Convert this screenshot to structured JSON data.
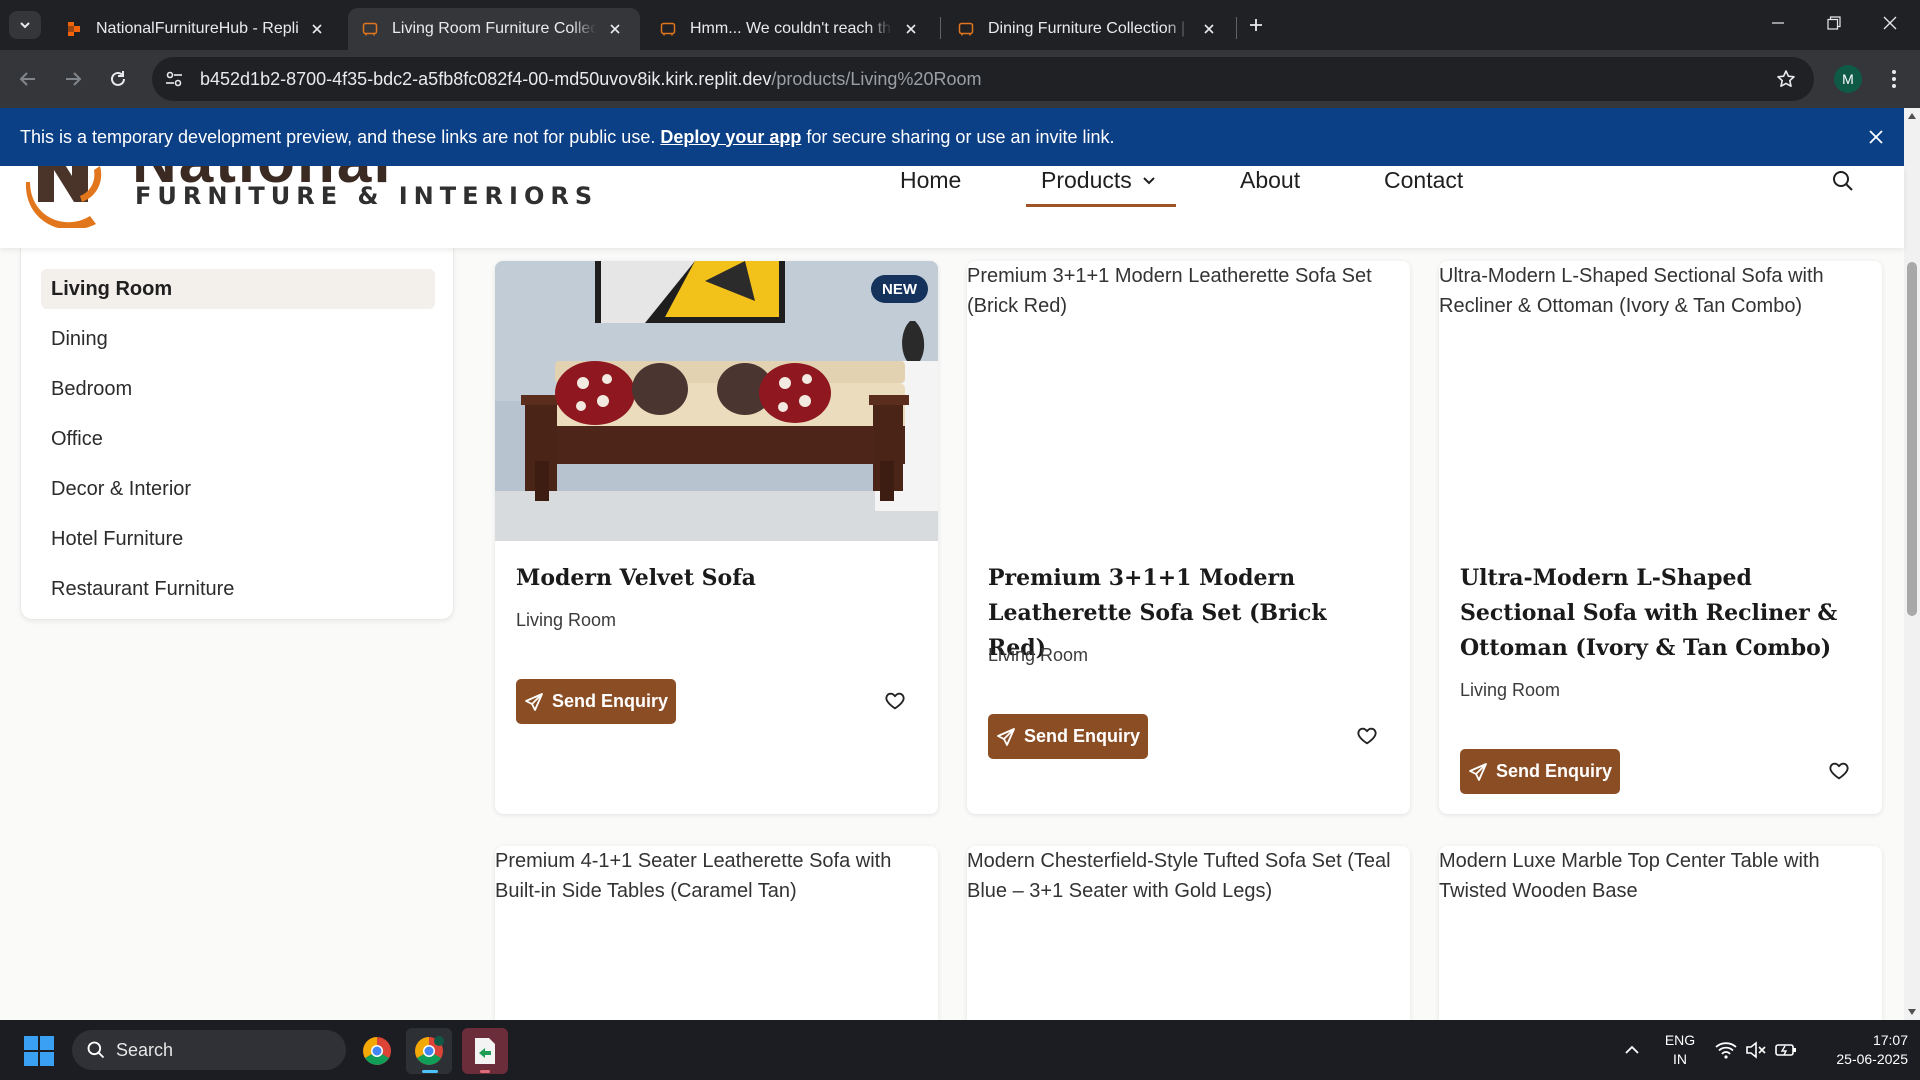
{
  "browser": {
    "tabs": [
      {
        "title": "NationalFurnitureHub - Replit",
        "active": false
      },
      {
        "title": "Living Room Furniture Collectio",
        "active": true
      },
      {
        "title": "Hmm... We couldn't reach this a",
        "active": false
      },
      {
        "title": "Dining Furniture Collection | Na",
        "active": false
      }
    ],
    "url_host": "b452d1b2-8700-4f35-bdc2-a5fb8fc082f4-00-md50uvov8ik.kirk.replit.dev",
    "url_path": "/products/Living%20Room",
    "profile_initial": "M"
  },
  "banner": {
    "text_before": "This is a temporary development preview, and these links are not for public use.",
    "link": "Deploy your app",
    "text_after": "for secure sharing or use an invite link."
  },
  "header": {
    "logo_name": "National",
    "logo_tagline": "FURNITURE & INTERIORS",
    "nav": [
      "Home",
      "Products",
      "About",
      "Contact"
    ],
    "active_nav": "Products"
  },
  "sidebar": {
    "categories": [
      "Living Room",
      "Dining",
      "Bedroom",
      "Office",
      "Decor & Interior",
      "Hotel Furniture",
      "Restaurant Furniture"
    ],
    "active": "Living Room"
  },
  "products": [
    {
      "name": "Modern Velvet Sofa",
      "category": "Living Room",
      "badge": "NEW",
      "image_alt": "",
      "enquiry": "Send Enquiry"
    },
    {
      "name": "Premium 3+1+1 Modern Leatherette Sofa Set (Brick Red)",
      "category": "Living Room",
      "image_alt": "Premium 3+1+1 Modern Leatherette Sofa Set (Brick Red)",
      "enquiry": "Send Enquiry"
    },
    {
      "name": "Ultra-Modern L-Shaped Sectional Sofa with Recliner & Ottoman (Ivory & Tan Combo)",
      "category": "Living Room",
      "image_alt": "Ultra-Modern L-Shaped Sectional Sofa with Recliner & Ottoman (Ivory & Tan Combo)",
      "enquiry": "Send Enquiry"
    },
    {
      "image_alt": "Premium 4-1+1 Seater Leatherette Sofa with Built-in Side Tables (Caramel Tan)"
    },
    {
      "image_alt": "Modern Chesterfield-Style Tufted Sofa Set (Teal Blue – 3+1 Seater with Gold Legs)"
    },
    {
      "image_alt": "Modern Luxe Marble Top Center Table with Twisted Wooden Base"
    }
  ],
  "taskbar": {
    "search_placeholder": "Search",
    "lang": "ENG",
    "region": "IN",
    "time": "17:07",
    "date": "25-06-2025"
  },
  "colors": {
    "accent_brown": "#8b4e24",
    "banner_blue": "#0b3f86",
    "badge_navy": "#14325c",
    "logo_orange": "#e2761d"
  }
}
